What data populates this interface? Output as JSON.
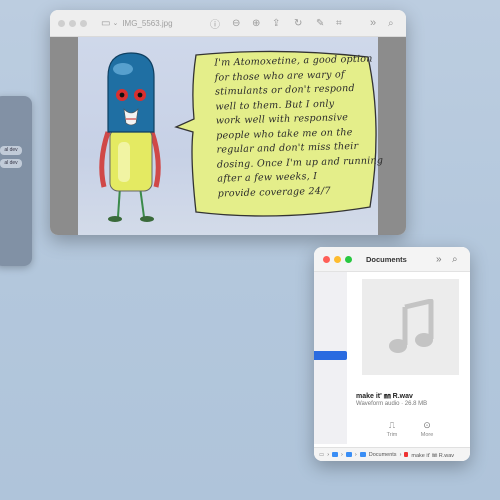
{
  "side_panel": {
    "chips": [
      "al dev",
      "al dev"
    ]
  },
  "preview_window": {
    "title": "IMG_5563.jpg",
    "bubble_lines": [
      "I'm Atomoxetine, a good option",
      "for those who are wary of",
      "stimulants or don't respond",
      "well to them. But I only",
      "work well with responsive",
      "people who take me on the",
      "regular and don't miss their",
      "dosing. Once I'm up and running",
      "after a few weeks, I",
      "provide coverage 24/7"
    ]
  },
  "documents_window": {
    "title": "Documents",
    "file_name": "make it' ㎜ R.wav",
    "file_meta": "Waveform audio · 26.8 MB",
    "actions": [
      {
        "label": "Trim",
        "icon": "trim-icon"
      },
      {
        "label": "More",
        "icon": "more-icon"
      }
    ],
    "path": [
      "Documents",
      "make it' ㎜ R.wav"
    ]
  },
  "colors": {
    "accent": "#2a6be0",
    "bubble": "#e4ee8a",
    "pill_blue": "#1f6fa3"
  }
}
